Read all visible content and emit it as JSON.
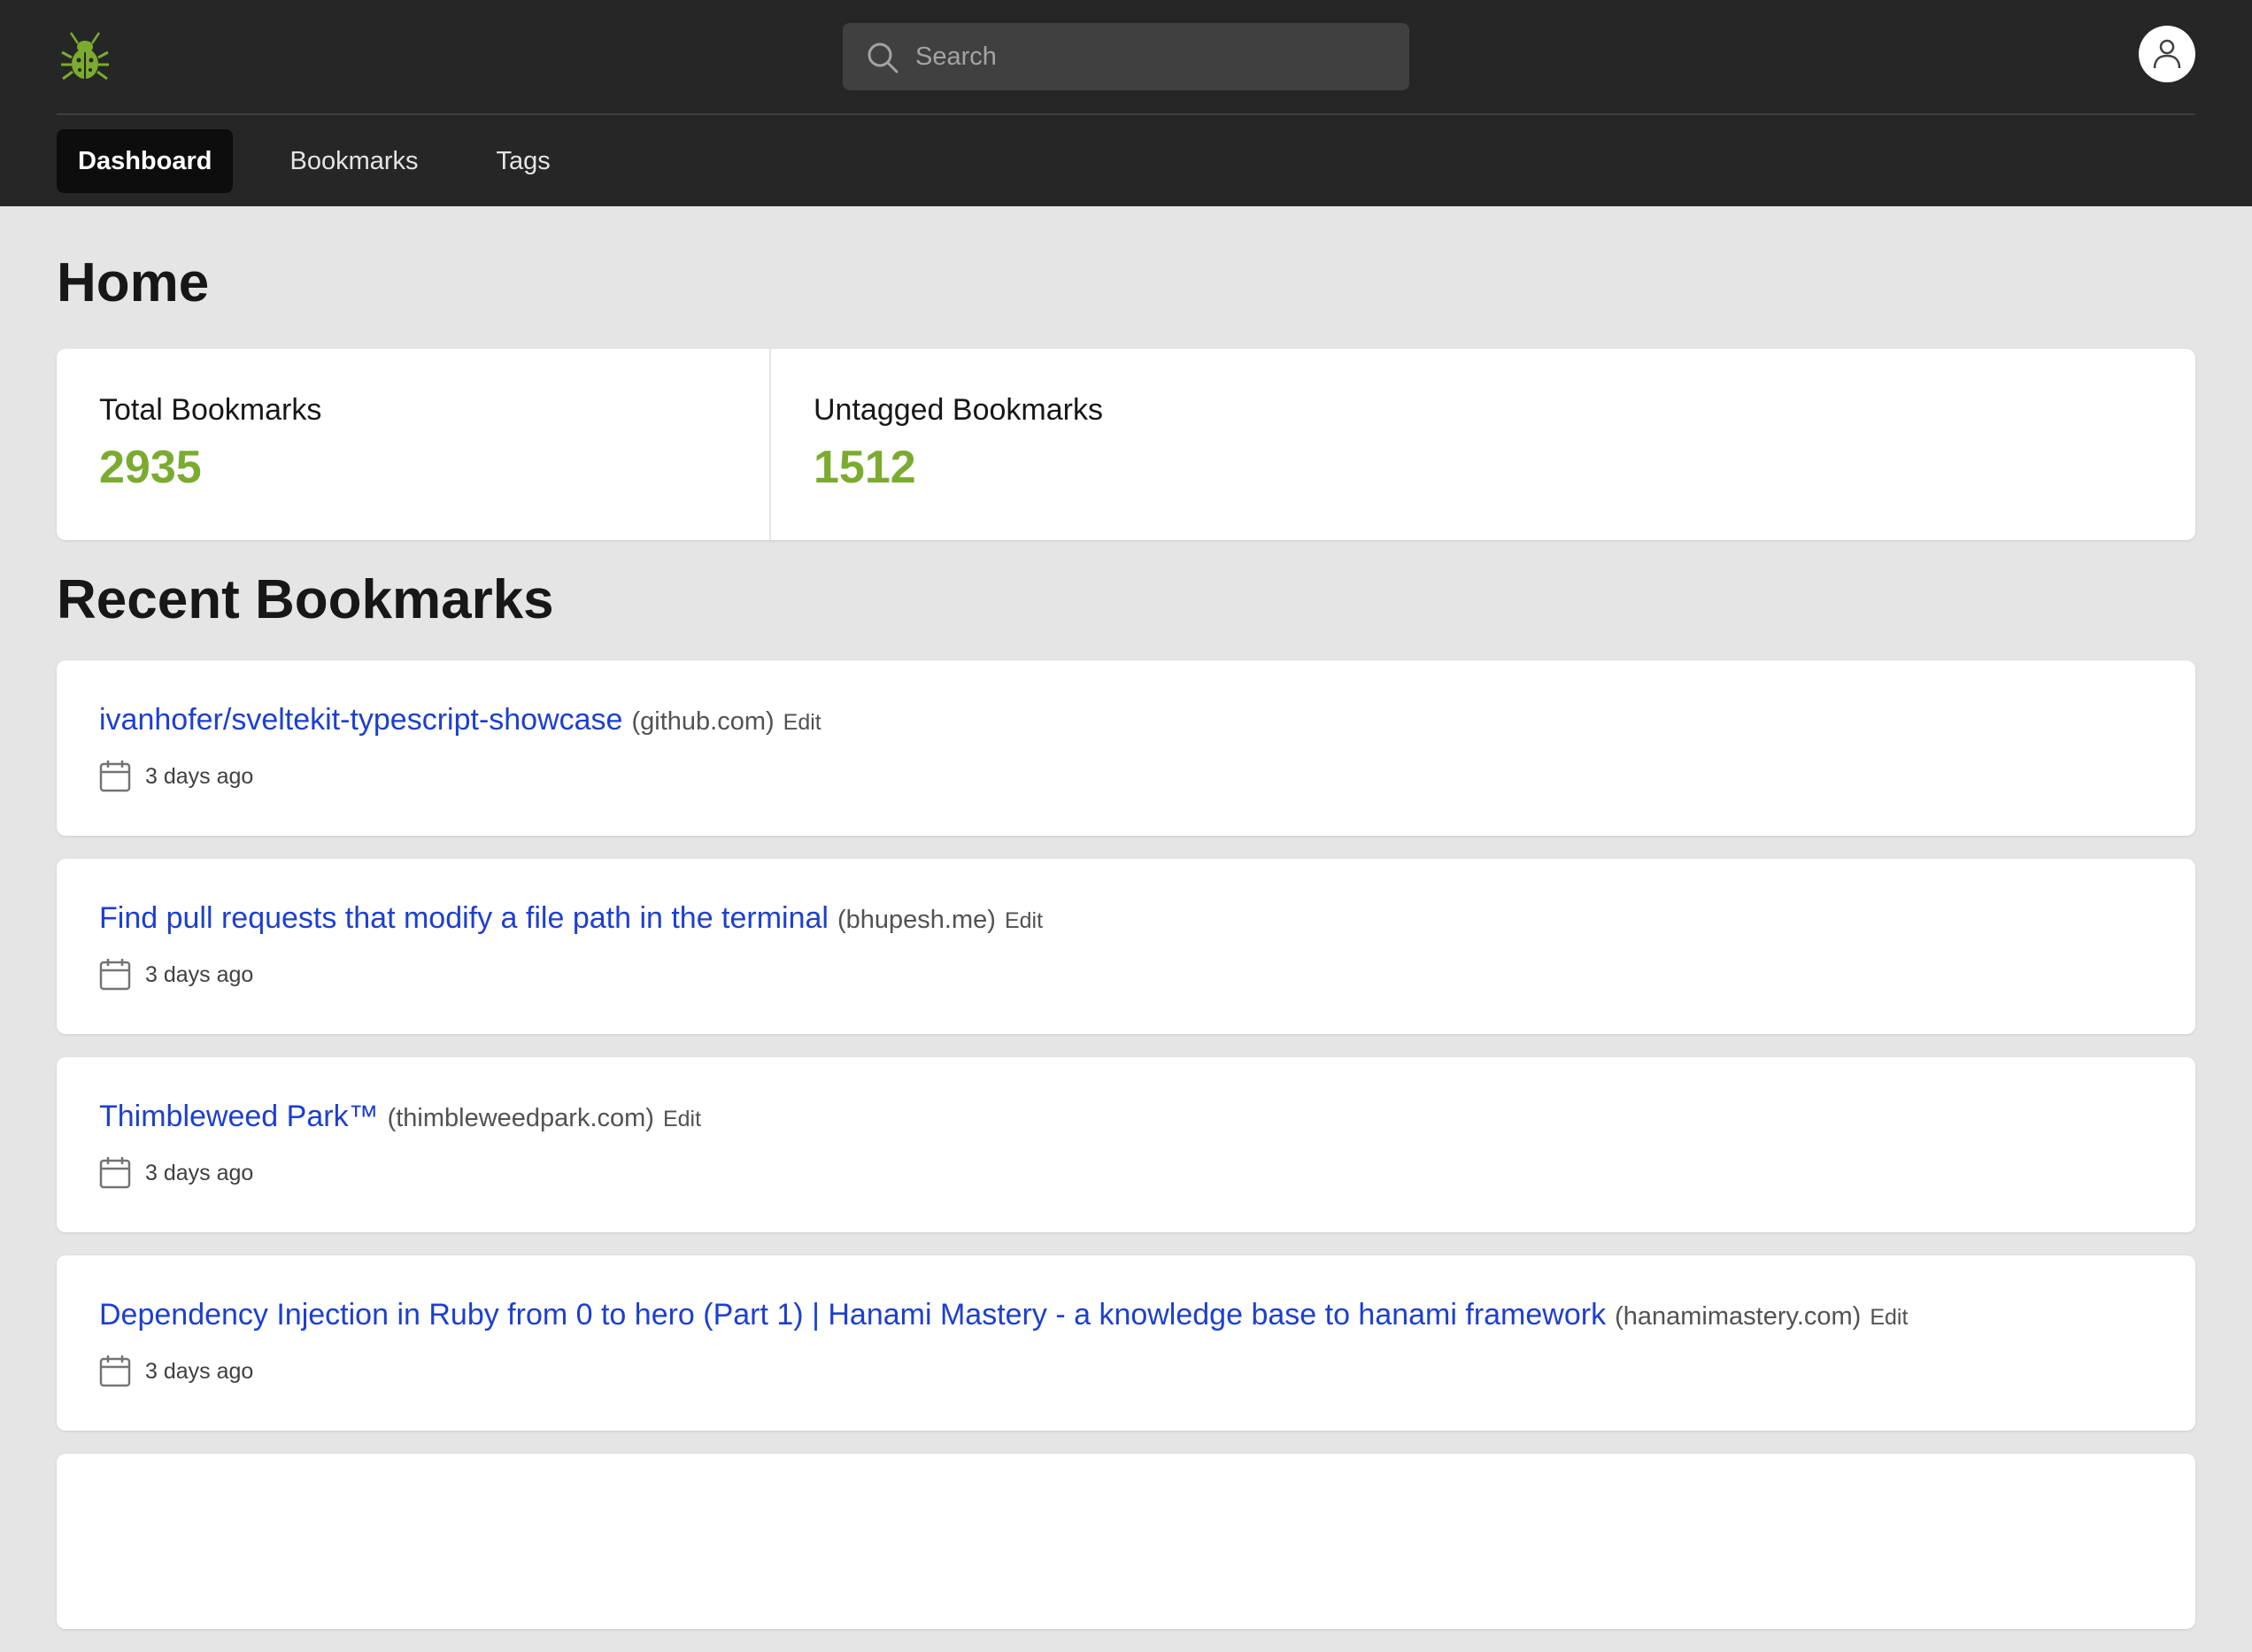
{
  "header": {
    "logo_icon": "bug-icon",
    "search": {
      "placeholder": "Search",
      "value": ""
    },
    "avatar_icon": "user-icon"
  },
  "nav": {
    "items": [
      {
        "label": "Dashboard",
        "active": true
      },
      {
        "label": "Bookmarks",
        "active": false
      },
      {
        "label": "Tags",
        "active": false
      }
    ]
  },
  "main": {
    "title": "Home",
    "stats": {
      "total_label": "Total Bookmarks",
      "total_value": "2935",
      "untagged_label": "Untagged Bookmarks",
      "untagged_value": "1512"
    },
    "recent_title": "Recent Bookmarks",
    "edit_label": "Edit",
    "bookmarks": [
      {
        "title": "ivanhofer/sveltekit-typescript-showcase",
        "domain": "(github.com)",
        "date": "3 days ago"
      },
      {
        "title": "Find pull requests that modify a file path in the terminal",
        "domain": "(bhupesh.me)",
        "date": "3 days ago"
      },
      {
        "title": "Thimbleweed Park™",
        "domain": "(thimbleweedpark.com)",
        "date": "3 days ago"
      },
      {
        "title": "Dependency Injection in Ruby from 0 to hero (Part 1) | Hanami Mastery - a knowledge base to hanami framework",
        "domain": "(hanamimastery.com)",
        "date": "3 days ago"
      }
    ]
  },
  "colors": {
    "header_bg": "#262626",
    "page_bg": "#e5e5e5",
    "accent_green": "#7bab2f",
    "link_blue": "#1d3fcf"
  }
}
